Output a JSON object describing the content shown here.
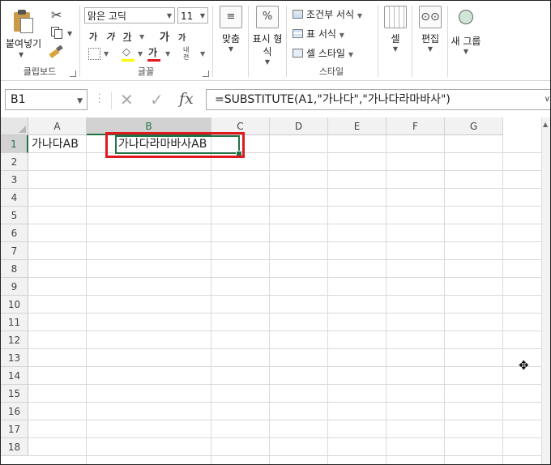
{
  "ribbon": {
    "clipboard": {
      "paste": "붙여넣기",
      "group": "클립보드"
    },
    "font": {
      "name": "맑은 고딕",
      "size": "11",
      "bold": "가",
      "italic": "가",
      "underline": "가",
      "grow": "가",
      "shrink": "가",
      "font_color": "가",
      "phonetic": "내천",
      "group": "글꼴"
    },
    "alignment": {
      "label": "맞춤"
    },
    "number": {
      "icon": "%",
      "label": "표시 형식"
    },
    "styles": {
      "conditional": "조건부 서식",
      "table": "표 서식",
      "cell": "셀 스타일",
      "group": "스타일"
    },
    "cells": {
      "label": "셀"
    },
    "editing": {
      "label": "편집"
    },
    "new_group": {
      "label": "새 그룹"
    }
  },
  "formula_bar": {
    "name_box": "B1",
    "formula": "=SUBSTITUTE(A1,\"가나다\",\"가나다라마바사\")"
  },
  "grid": {
    "columns": [
      "A",
      "B",
      "C",
      "D",
      "E",
      "F",
      "G"
    ],
    "rows": [
      "1",
      "2",
      "3",
      "4",
      "5",
      "6",
      "7",
      "8",
      "9",
      "10",
      "11",
      "12",
      "13",
      "14",
      "15",
      "16",
      "17",
      "18"
    ],
    "cells": {
      "A1": "가나다AB",
      "B1": "가나다라마바사AB"
    }
  },
  "colors": {
    "accent": "#217346",
    "highlight": "#e0191e"
  }
}
